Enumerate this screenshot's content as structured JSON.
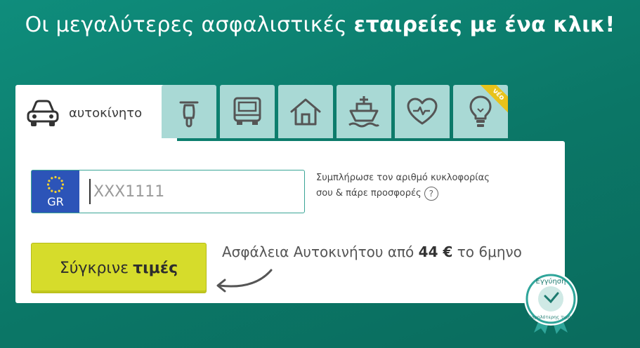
{
  "headline": {
    "light": "Οι μεγαλύτερες ασφαλιστικές",
    "bold": "εταιρείες με ένα κλικ!"
  },
  "tabs": {
    "active_label": "αυτοκίνητο",
    "items": [
      {
        "icon": "car-icon"
      },
      {
        "icon": "motorcycle-icon"
      },
      {
        "icon": "truck-icon"
      },
      {
        "icon": "house-icon"
      },
      {
        "icon": "ship-icon"
      },
      {
        "icon": "heart-icon"
      },
      {
        "icon": "lightbulb-icon",
        "ribbon": "νέο"
      }
    ]
  },
  "plate": {
    "country": "GR",
    "placeholder": "XXX1111"
  },
  "hint": {
    "line1": "Συμπλήρωσε τον αριθμό κυκλοφορίας",
    "line2": "σου & πάρε προσφορές",
    "help_symbol": "?"
  },
  "compare_button": {
    "normal": "Σύγκρινε",
    "bold": "τιμές"
  },
  "price": {
    "prefix": "Ασφάλεια Αυτοκινήτου από",
    "amount": "44 €",
    "suffix": "το 6μηνο"
  },
  "badge": {
    "title": "Εγγύηση",
    "subtitle": "Χαμηλότερης τιμής"
  },
  "colors": {
    "background": "#0b7767",
    "tab_inactive": "#a9d9d5",
    "button": "#d6dc2b",
    "eu_blue": "#2c54b8",
    "ribbon": "#e8c21a"
  }
}
